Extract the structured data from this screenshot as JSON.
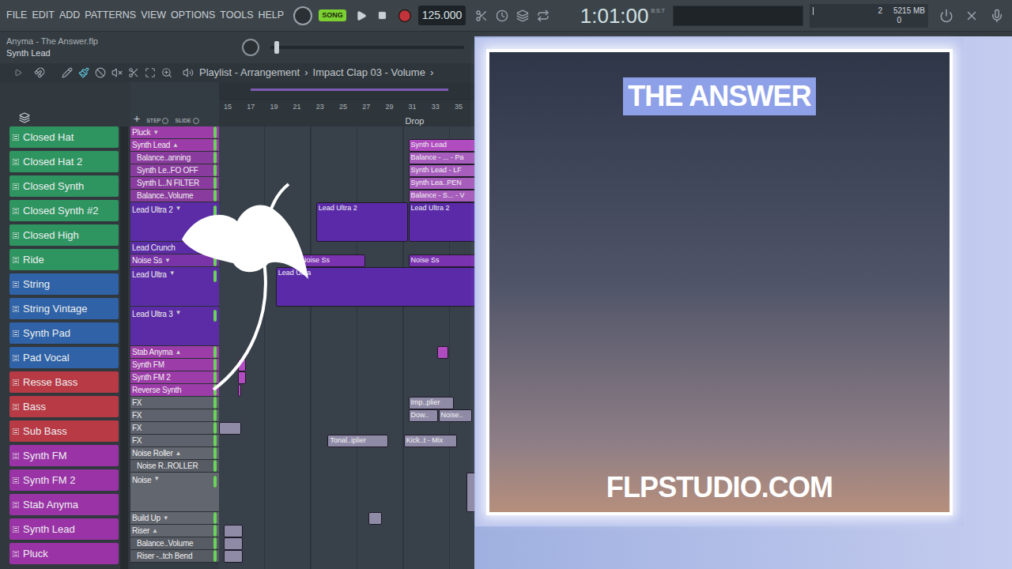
{
  "menu": [
    "FILE",
    "EDIT",
    "ADD",
    "PATTERNS",
    "VIEW",
    "OPTIONS",
    "TOOLS",
    "HELP"
  ],
  "transport": {
    "mode": "SONG",
    "song_mode": true,
    "tempo": "125.000",
    "time": "1:01:00",
    "time_format": "B:S:T",
    "recording": false
  },
  "meters": {
    "voices": "2",
    "memory": "5215 MB",
    "cpu": "0"
  },
  "project": {
    "file": "Anyma - The Answer.flp",
    "hint": "Synth Lead"
  },
  "master_slider": {
    "level": 0.02
  },
  "playlist": {
    "breadcrumb": [
      "Playlist - Arrangement",
      "Impact Clap 03 - Volume"
    ],
    "separator": "›",
    "add": "+",
    "step_label": "STEP",
    "slide_label": "SLIDE",
    "ruler": [
      "15",
      "17",
      "19",
      "21",
      "23",
      "25",
      "27",
      "29",
      "31",
      "33",
      "35"
    ],
    "markers": [
      {
        "label": "Drop",
        "bar": 31
      }
    ],
    "tracks": [
      {
        "name": "Pluck",
        "kind": "normal",
        "arrow": "▼",
        "color": "#9c3ca8",
        "enabled": true
      },
      {
        "name": "Synth Lead",
        "kind": "normal",
        "arrow": "▲",
        "color": "#9c3ca8",
        "enabled": true
      },
      {
        "name": "Balance..anning",
        "kind": "sub",
        "arrow": "",
        "color": "#8a3b9e",
        "enabled": true
      },
      {
        "name": "Synth Le..FO OFF",
        "kind": "sub",
        "arrow": "",
        "color": "#8a3b9e",
        "enabled": true
      },
      {
        "name": "Synth L..N FILTER",
        "kind": "sub",
        "arrow": "",
        "color": "#8a3b9e",
        "enabled": true
      },
      {
        "name": "Balance..Volume",
        "kind": "sub",
        "arrow": "",
        "color": "#8a3b9e",
        "enabled": true
      },
      {
        "name": "Lead Ultra 2",
        "kind": "tall",
        "arrow": "▼",
        "color": "#5b2ca6",
        "enabled": true
      },
      {
        "name": "Lead Crunch",
        "kind": "normal",
        "arrow": "",
        "color": "#5b2ca6",
        "enabled": true
      },
      {
        "name": "Noise Ss",
        "kind": "normal",
        "arrow": "▼",
        "color": "#7a34a8",
        "enabled": true
      },
      {
        "name": "Lead Ultra",
        "kind": "tall",
        "arrow": "▼",
        "color": "#5b2ca6",
        "enabled": true
      },
      {
        "name": "Lead Ultra 3",
        "kind": "tall",
        "arrow": "▼",
        "color": "#5b2ca6",
        "enabled": true
      },
      {
        "name": "Stab Anyma",
        "kind": "normal",
        "arrow": "▲",
        "color": "#9c3ca8",
        "enabled": true
      },
      {
        "name": "Synth FM",
        "kind": "normal",
        "arrow": "",
        "color": "#9c3ca8",
        "enabled": true
      },
      {
        "name": "Synth FM 2",
        "kind": "normal",
        "arrow": "",
        "color": "#9c3ca8",
        "enabled": true
      },
      {
        "name": "Reverse Synth",
        "kind": "normal",
        "arrow": "",
        "color": "#9c3ca8",
        "enabled": true
      },
      {
        "name": "FX",
        "kind": "normal",
        "arrow": "",
        "color": "#5d626c",
        "enabled": true
      },
      {
        "name": "FX",
        "kind": "normal",
        "arrow": "",
        "color": "#5d626c",
        "enabled": true
      },
      {
        "name": "FX",
        "kind": "normal",
        "arrow": "",
        "color": "#5d626c",
        "enabled": true
      },
      {
        "name": "FX",
        "kind": "normal",
        "arrow": "",
        "color": "#5d626c",
        "enabled": true
      },
      {
        "name": "Noise Roller",
        "kind": "normal",
        "arrow": "▲",
        "color": "#62666f",
        "enabled": true
      },
      {
        "name": "Noise R..ROLLER",
        "kind": "sub",
        "arrow": "",
        "color": "#575b64",
        "enabled": true
      },
      {
        "name": "Noise",
        "kind": "tall",
        "arrow": "▼",
        "color": "#62666f",
        "enabled": true
      },
      {
        "name": "Build Up",
        "kind": "normal",
        "arrow": "▼",
        "color": "#62666f",
        "enabled": true
      },
      {
        "name": "Riser",
        "kind": "normal",
        "arrow": "▲",
        "color": "#62666f",
        "enabled": true
      },
      {
        "name": "Balance..Volume",
        "kind": "sub",
        "arrow": "",
        "color": "#575b64",
        "enabled": true
      },
      {
        "name": "Riser -..tch Bend",
        "kind": "sub",
        "arrow": "",
        "color": "#575b64",
        "enabled": true
      }
    ],
    "clips": [
      {
        "track": 1,
        "start": 31,
        "length": 6,
        "label": "Synth Lead",
        "color": "#b04cc0"
      },
      {
        "track": 2,
        "start": 31,
        "length": 6,
        "label": "Balance - ... - Pa",
        "color": "#a65dbb"
      },
      {
        "track": 3,
        "start": 31,
        "length": 6,
        "label": "Synth Lead - LF",
        "color": "#a65dbb"
      },
      {
        "track": 4,
        "start": 31,
        "length": 6,
        "label": "Synth Lea..PEN",
        "color": "#a65dbb"
      },
      {
        "track": 5,
        "start": 31,
        "length": 6,
        "label": "Balance - S... - V",
        "color": "#a65dbb"
      },
      {
        "track": 6,
        "start": 23,
        "length": 8,
        "label": "Lead Ultra 2",
        "color": "#5a2aa8"
      },
      {
        "track": 6,
        "start": 31,
        "length": 6,
        "label": "Lead Ultra 2",
        "color": "#5a2aa8"
      },
      {
        "track": 8,
        "start": 21.5,
        "length": 5.8,
        "label": "Noise Ss",
        "color": "#7a32b0"
      },
      {
        "track": 8,
        "start": 31,
        "length": 6,
        "label": "Noise Ss",
        "color": "#7a32b0"
      },
      {
        "track": 9,
        "start": 19.5,
        "length": 18,
        "label": "Lead Ultra",
        "color": "#5a2aa8"
      },
      {
        "track": 11,
        "start": 33.5,
        "length": 1,
        "label": "",
        "color": "#b04cc0"
      },
      {
        "track": 12,
        "start": 16.2,
        "length": 0.8,
        "label": "",
        "color": "#b04cc0"
      },
      {
        "track": 13,
        "start": 16.2,
        "length": 0.8,
        "label": "",
        "color": "#b04cc0"
      },
      {
        "track": 14,
        "start": 16.2,
        "length": 0.3,
        "label": "",
        "color": "#b04cc0"
      },
      {
        "track": 15,
        "start": 31,
        "length": 4,
        "label": "Imp..plier",
        "color": "#8f8aa6"
      },
      {
        "track": 16,
        "start": 31,
        "length": 2.6,
        "label": "Dow..",
        "color": "#8f8aa6"
      },
      {
        "track": 16,
        "start": 33.6,
        "length": 3,
        "label": "Noise..",
        "color": "#8f8aa6"
      },
      {
        "track": 17,
        "start": 14.6,
        "length": 2,
        "label": "",
        "color": "#8f8aa6"
      },
      {
        "track": 18,
        "start": 24,
        "length": 5.3,
        "label": "Tonal..iplier",
        "color": "#8f8aa6"
      },
      {
        "track": 18,
        "start": 30.6,
        "length": 4.7,
        "label": "Kick..t - Mix",
        "color": "#8f8aa6"
      },
      {
        "track": 21,
        "start": 36,
        "length": 2,
        "label": "",
        "color": "#8f8aa6"
      },
      {
        "track": 22,
        "start": 27.5,
        "length": 1.3,
        "label": "",
        "color": "#8f8aa6"
      },
      {
        "track": 23,
        "start": 15,
        "length": 1.7,
        "label": "",
        "color": "#8f8aa6"
      },
      {
        "track": 24,
        "start": 15,
        "length": 1.7,
        "label": "",
        "color": "#8f8aa6"
      },
      {
        "track": 25,
        "start": 15,
        "length": 1.7,
        "label": "",
        "color": "#8f8aa6"
      }
    ]
  },
  "channels": [
    {
      "name": "Closed Hat",
      "color": "#2f9560"
    },
    {
      "name": "Closed Hat 2",
      "color": "#2f9560"
    },
    {
      "name": "Closed Synth",
      "color": "#2f9560"
    },
    {
      "name": "Closed Synth #2",
      "color": "#2f9560"
    },
    {
      "name": "Closed High",
      "color": "#2f9560"
    },
    {
      "name": "Ride",
      "color": "#2f9560"
    },
    {
      "name": "String",
      "color": "#2f62a6"
    },
    {
      "name": "String Vintage",
      "color": "#2f62a6"
    },
    {
      "name": "Synth Pad",
      "color": "#2f62a6"
    },
    {
      "name": "Pad Vocal",
      "color": "#2f62a6"
    },
    {
      "name": "Resse Bass",
      "color": "#b73a45"
    },
    {
      "name": "Bass",
      "color": "#b73a45"
    },
    {
      "name": "Sub Bass",
      "color": "#b73a45"
    },
    {
      "name": "Synth FM",
      "color": "#9a33a6"
    },
    {
      "name": "Synth FM 2",
      "color": "#9a33a6"
    },
    {
      "name": "Stab Anyma",
      "color": "#9a33a6"
    },
    {
      "name": "Synth Lead",
      "color": "#9a33a6"
    },
    {
      "name": "Pluck",
      "color": "#9a33a6"
    }
  ],
  "cover": {
    "title": "THE ANSWER",
    "site": "FLPSTUDIO.COM"
  }
}
